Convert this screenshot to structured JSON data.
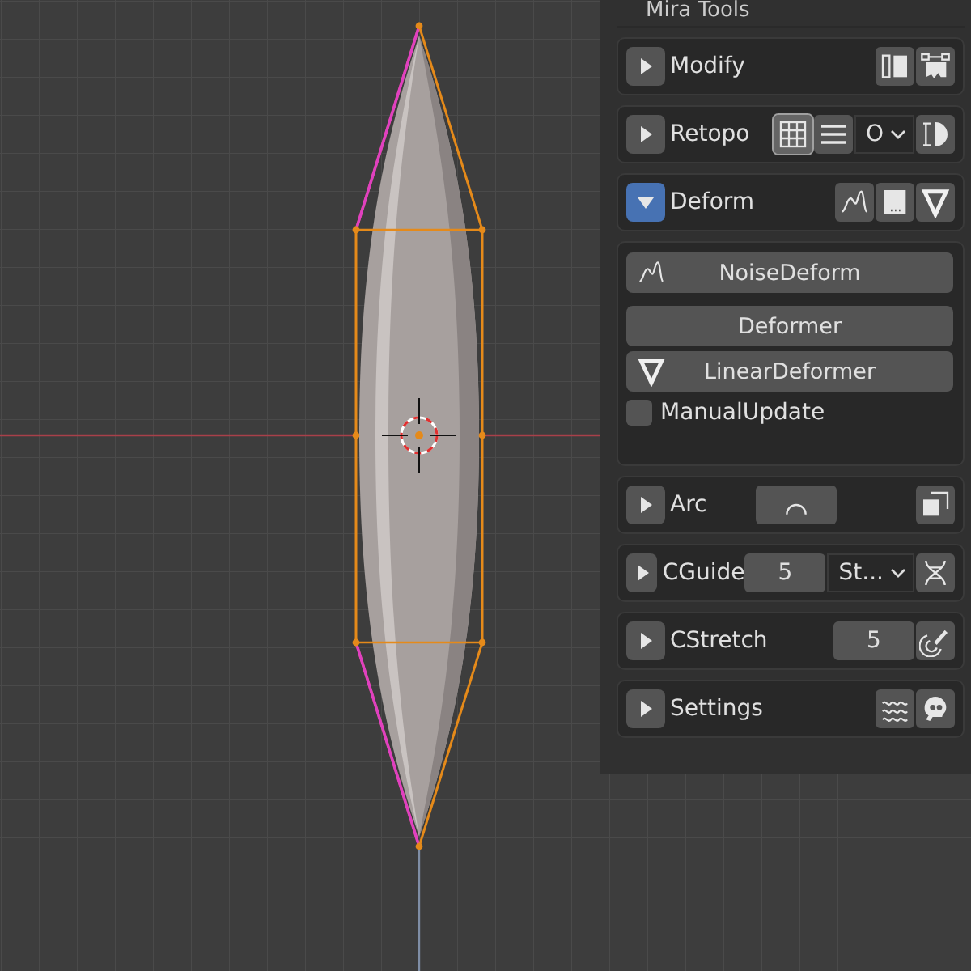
{
  "panel": {
    "title": "Mira Tools",
    "sections": [
      {
        "label": "Modify",
        "expanded": false,
        "tools": [
          {
            "kind": "icon",
            "selected": false
          },
          {
            "kind": "icon",
            "selected": false
          }
        ]
      },
      {
        "label": "Retopo",
        "expanded": false,
        "tools": [
          {
            "kind": "icon",
            "selected": true
          },
          {
            "kind": "icon",
            "selected": false
          },
          {
            "kind": "dropdown",
            "value": "O"
          },
          {
            "kind": "icon",
            "selected": false
          }
        ]
      },
      {
        "label": "Deform",
        "expanded": true,
        "tools": [
          {
            "kind": "icon",
            "selected": false
          },
          {
            "kind": "icon",
            "selected": false
          },
          {
            "kind": "icon",
            "selected": false
          }
        ],
        "body": [
          [
            {
              "kind": "icon-button",
              "label": "NoiseDeform"
            }
          ],
          [
            {
              "kind": "button",
              "label": "Deformer"
            },
            {
              "kind": "icon-button",
              "label": "LinearDeformer"
            },
            {
              "kind": "checkbox",
              "label": "ManualUpdate",
              "checked": false
            }
          ]
        ]
      },
      {
        "label": "Arc",
        "expanded": false,
        "tools": [
          {
            "kind": "wide-icon",
            "selected": false
          },
          {
            "kind": "icon",
            "selected": false
          }
        ]
      },
      {
        "label": "CGuide",
        "expanded": false,
        "tools": [
          {
            "kind": "number",
            "value": "5"
          },
          {
            "kind": "dropdown",
            "value": "St..."
          },
          {
            "kind": "icon",
            "selected": false
          }
        ]
      },
      {
        "label": "CStretch",
        "expanded": false,
        "tools": [
          {
            "kind": "number",
            "value": "5"
          },
          {
            "kind": "icon",
            "selected": false
          }
        ]
      },
      {
        "label": "Settings",
        "expanded": false,
        "tools": [
          {
            "kind": "icon",
            "selected": false
          },
          {
            "kind": "icon",
            "selected": false
          }
        ]
      }
    ]
  }
}
